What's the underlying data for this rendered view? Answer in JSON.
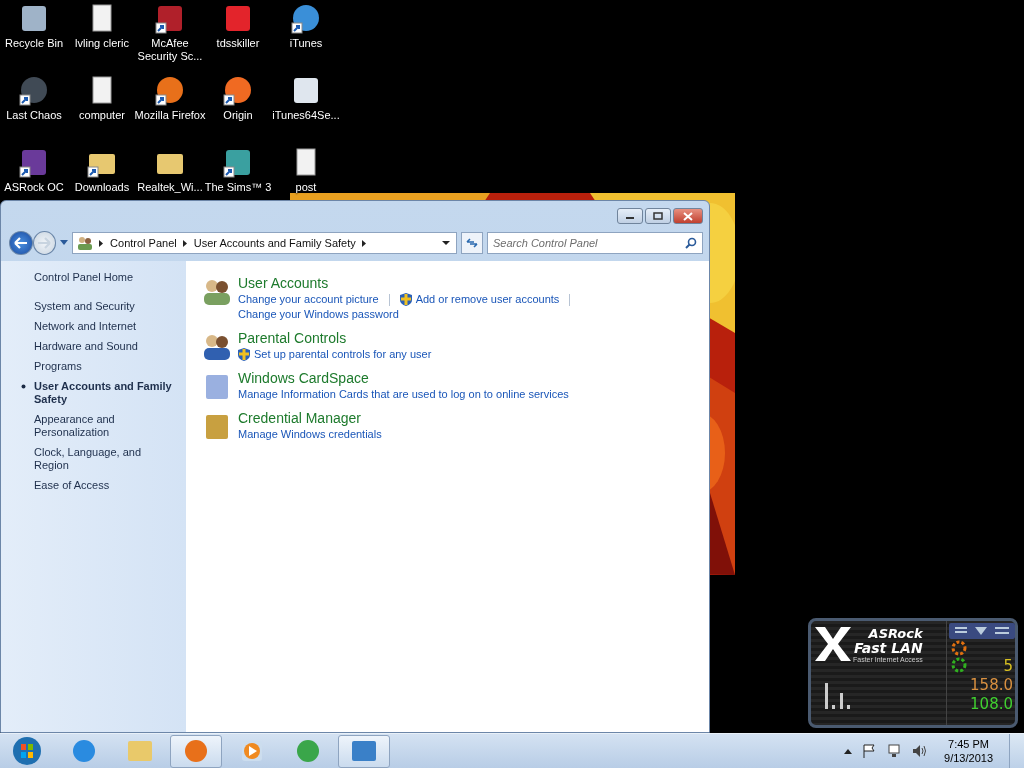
{
  "desktop_icons": [
    {
      "label": "Recycle Bin",
      "kind": "bin",
      "shortcut": false
    },
    {
      "label": "lvling cleric",
      "kind": "doc",
      "shortcut": false
    },
    {
      "label": "McAfee Security Sc...",
      "kind": "shield",
      "shortcut": true
    },
    {
      "label": "tdsskiller",
      "kind": "k",
      "shortcut": false
    },
    {
      "label": "iTunes",
      "kind": "note",
      "shortcut": true
    },
    {
      "label": "Last Chaos",
      "kind": "orb",
      "shortcut": true
    },
    {
      "label": "computer",
      "kind": "doc",
      "shortcut": false
    },
    {
      "label": "Mozilla Firefox",
      "kind": "fox",
      "shortcut": true
    },
    {
      "label": "Origin",
      "kind": "origin",
      "shortcut": true
    },
    {
      "label": "iTunes64Se...",
      "kind": "box",
      "shortcut": false
    },
    {
      "label": "ASRock OC",
      "kind": "oc",
      "shortcut": true
    },
    {
      "label": "Downloads",
      "kind": "folder",
      "shortcut": true
    },
    {
      "label": "Realtek_Wi...",
      "kind": "folder",
      "shortcut": false
    },
    {
      "label": "The Sims™ 3",
      "kind": "sims",
      "shortcut": true
    },
    {
      "label": "post",
      "kind": "doc",
      "shortcut": false
    }
  ],
  "window": {
    "breadcrumbs": [
      "Control Panel",
      "User Accounts and Family Safety"
    ],
    "search": {
      "placeholder": "Search Control Panel"
    },
    "sidebar": [
      {
        "label": "Control Panel Home",
        "selected": false
      },
      {
        "label": "System and Security",
        "selected": false
      },
      {
        "label": "Network and Internet",
        "selected": false
      },
      {
        "label": "Hardware and Sound",
        "selected": false
      },
      {
        "label": "Programs",
        "selected": false
      },
      {
        "label": "User Accounts and Family Safety",
        "selected": true
      },
      {
        "label": "Appearance and Personalization",
        "selected": false
      },
      {
        "label": "Clock, Language, and Region",
        "selected": false
      },
      {
        "label": "Ease of Access",
        "selected": false
      }
    ],
    "categories": [
      {
        "title": "User Accounts",
        "kind": "users",
        "rows": [
          [
            {
              "text": "Change your account picture",
              "shield": false
            },
            {
              "text": "Add or remove user accounts",
              "shield": true
            }
          ],
          [
            {
              "text": "Change your Windows password",
              "shield": false
            }
          ]
        ]
      },
      {
        "title": "Parental Controls",
        "kind": "parental",
        "rows": [
          [
            {
              "text": "Set up parental controls for any user",
              "shield": true
            }
          ]
        ]
      },
      {
        "title": "Windows CardSpace",
        "kind": "cards",
        "rows": [
          [
            {
              "text": "Manage Information Cards that are used to log on to online services",
              "shield": false
            }
          ]
        ]
      },
      {
        "title": "Credential Manager",
        "kind": "vault",
        "rows": [
          [
            {
              "text": "Manage Windows credentials",
              "shield": false
            }
          ]
        ]
      }
    ]
  },
  "widget": {
    "brand": "ASRock",
    "title": "Fast LAN",
    "subtitle": "Faster Internet Access",
    "readings": [
      "5",
      "158.0",
      "108.0"
    ]
  },
  "taskbar": {
    "apps": [
      {
        "kind": "ie",
        "active": false
      },
      {
        "kind": "explorer",
        "active": false
      },
      {
        "kind": "firefox",
        "active": true
      },
      {
        "kind": "media",
        "active": false
      },
      {
        "kind": "chrome",
        "active": false
      },
      {
        "kind": "control",
        "active": true
      }
    ],
    "time": "7:45 PM",
    "date": "9/13/2013"
  }
}
